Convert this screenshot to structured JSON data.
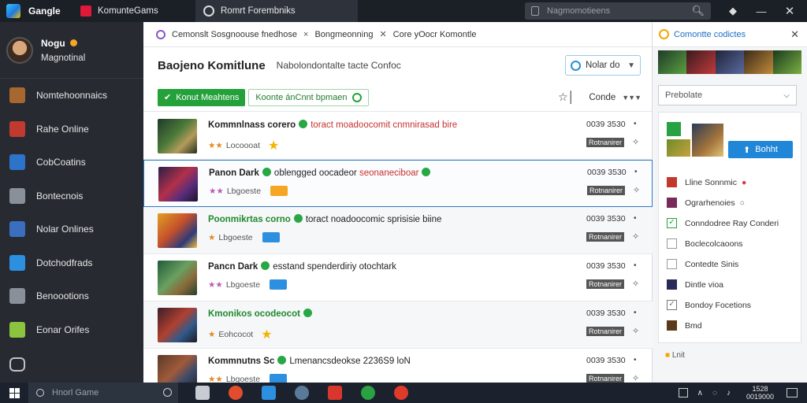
{
  "titlebar": {
    "app_name": "Gangle",
    "tab1": "KomunteGams",
    "tab2": "Romrt Forembniks",
    "search_placeholder": "Nagmomotieens",
    "buttons": [
      "minimize",
      "maximize",
      "close"
    ]
  },
  "sidebar": {
    "profile_name": "Nogu",
    "profile_sub": "Magnotinal",
    "items": [
      {
        "label": "Nomtehoonnaics",
        "icon": "game-thumbnail-icon",
        "color": "#a8672f"
      },
      {
        "label": "Rahe Online",
        "icon": "game-thumbnail-icon",
        "color": "#c23a2f"
      },
      {
        "label": "CobCoatins",
        "icon": "game-thumbnail-icon",
        "color": "#2c73c9"
      },
      {
        "label": "Bontecnois",
        "icon": "gear-icon",
        "color": "#8a9099"
      },
      {
        "label": "Nolar Onlines",
        "icon": "game-thumbnail-icon",
        "color": "#3a6fc0"
      },
      {
        "label": "Dotchodfrads",
        "icon": "game-thumbnail-icon",
        "color": "#2d8fe0"
      },
      {
        "label": "Benoootions",
        "icon": "home-icon",
        "color": "#8a9099"
      },
      {
        "label": "Eonar Orifes",
        "icon": "game-thumbnail-icon",
        "color": "#8bc53f"
      }
    ],
    "bottom_icon": "chat-icon"
  },
  "main": {
    "tab_label_1": "Cemonslt Sosgnoouse fnedhose",
    "tab_label_2": "Bongmeonning",
    "tab_label_3": "Core yOocr Komontle",
    "title": "Baojeno Komitlune",
    "description": "Nabolondontalte tacte Confoc",
    "select_label": "Nolar",
    "select_value": "do",
    "filter_active": "Konut Meahtens",
    "filter_secondary": "Koonte ánCnnt bpmaen",
    "sort_label": "Conde",
    "sort_value": "▼▼▼",
    "games": [
      {
        "title": "Kommnlnass corero",
        "title_style": "t",
        "desc": "toract moadoocomit cnmnirasad bire",
        "desc_style": "r",
        "stars": "★★",
        "star_style": "",
        "sub": "Locoooat",
        "badge": "bigstar",
        "time": "0039 3530",
        "tag": "Rotnanirer",
        "thumb": "linear-gradient(135deg,#1e3a2a,#4d7a3a 45%,#b49a5a 70%,#22301f)"
      },
      {
        "title": "Panon Dark",
        "title_style": "t",
        "desc": "oblengged oocadeor",
        "desc_style": "",
        "extra": "seonaneciboar",
        "stars": "★★",
        "star_style": "p",
        "sub": "Lbgoeste",
        "badge": "orange",
        "time": "0039 3530",
        "tag": "Rotnanirer",
        "thumb": "linear-gradient(135deg,#2a1f4a,#b3304a 45%,#5a2d7a 70%,#1c1430)"
      },
      {
        "title": "Poonmikrtas corno",
        "title_style": "g",
        "desc": "toract noadoocomic sprisisie biine",
        "desc_style": "",
        "stars": "★",
        "star_style": "",
        "sub": "Lbgoeste",
        "badge": "blue",
        "time": "0039 3530",
        "tag": "Rotnanirer",
        "thumb": "linear-gradient(135deg,#e0a023,#c4502c 45%,#2d3a7a 75%,#f0c040)"
      },
      {
        "title": "Pancn Dark",
        "title_style": "t",
        "desc": "esstand spenderdiriy otochtark",
        "desc_style": "",
        "stars": "★★",
        "star_style": "p",
        "sub": "Lbgoeste",
        "badge": "blue",
        "time": "0039 3530",
        "tag": "Rotnanirer",
        "thumb": "linear-gradient(135deg,#1f5a3a,#6aa060 45%,#8a6a3a 70%,#253f2a)"
      },
      {
        "title": "Kmonikos ocodeocot",
        "title_style": "g",
        "desc": "",
        "desc_style": "",
        "stars": "★",
        "star_style": "",
        "sub": "Eohcocot",
        "badge": "bigstar",
        "time": "0039 3530",
        "tag": "Rotnanirer",
        "thumb": "linear-gradient(135deg,#3a1e2a,#b04030 45%,#305a8a 70%,#1c1a25)"
      },
      {
        "title": "Kommnutns Sc",
        "title_style": "t",
        "desc": "Lmenancsdeokse 2236S9 loN",
        "desc_style": "",
        "stars": "★★",
        "star_style": "",
        "sub": "Lbgoeste",
        "badge": "blue",
        "time": "0039 3530",
        "tag": "Rotnanirer",
        "thumb": "linear-gradient(135deg,#5a3a2a,#a05a3a 45%,#3a4a6a 70%,#2a2220)"
      }
    ]
  },
  "right_panel": {
    "header": "Comontte codictes",
    "select_value": "Prebolate",
    "play_button": "Bohht",
    "items": [
      {
        "label": "Lline Sonnmic",
        "icon": "game-icon",
        "color": "#c0392b",
        "suffix": "●"
      },
      {
        "label": "Ograrhenoies",
        "icon": "game-icon",
        "color": "#7a2a5a",
        "suffix": "○"
      },
      {
        "label": "Conndodree Ray Conderi",
        "icon": "checkbox-checked-icon",
        "color": "#24a13a"
      },
      {
        "label": "Boclecolcaoons",
        "icon": "checkbox-icon",
        "color": "#999"
      },
      {
        "label": "Contedte Sinis",
        "icon": "checkbox-icon",
        "color": "#999"
      },
      {
        "label": "Dintle vioa",
        "icon": "game-icon",
        "color": "#2a2a5a"
      },
      {
        "label": "Bondoy Focetions",
        "icon": "checkbox-checked-icon",
        "color": "#777"
      },
      {
        "label": "Bmd",
        "icon": "game-icon",
        "color": "#5a3a1a"
      }
    ],
    "footer": "Lnit"
  },
  "taskbar": {
    "search_placeholder": "Hnorl Game",
    "clock_line1": "1528",
    "clock_line2": "0019000",
    "apps": [
      {
        "icon": "file-explorer-icon",
        "color": "#c8ccd2"
      },
      {
        "icon": "chrome-icon",
        "color": "#e34c2c"
      },
      {
        "icon": "store-icon",
        "color": "#2d8fe0"
      },
      {
        "icon": "steam-icon",
        "color": "#5a7a9a"
      },
      {
        "icon": "game-app-icon",
        "color": "#d9362e"
      },
      {
        "icon": "xbox-icon",
        "color": "#2aa142"
      },
      {
        "icon": "record-icon",
        "color": "#e03a2a"
      }
    ]
  }
}
